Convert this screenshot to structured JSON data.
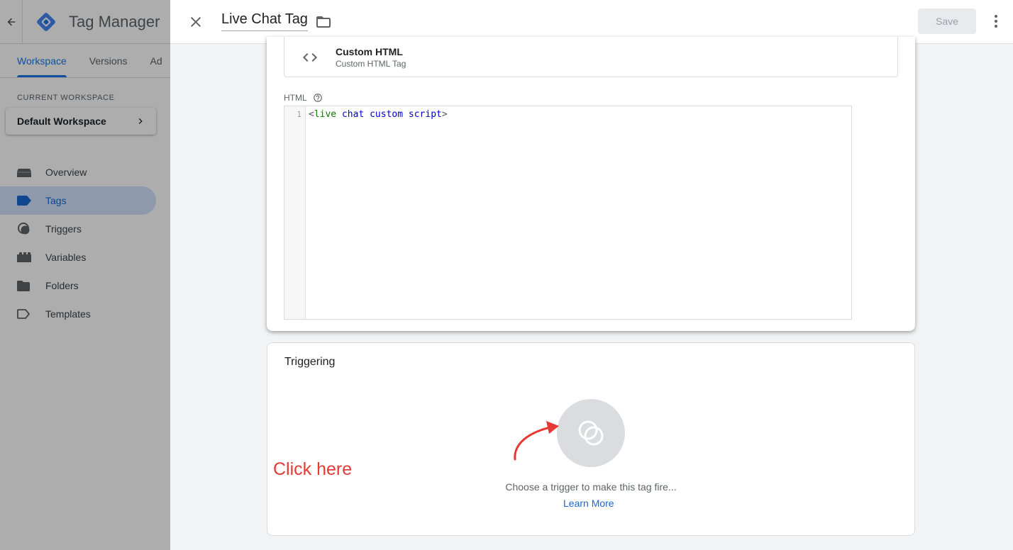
{
  "app": {
    "title": "Tag Manager",
    "tabs": [
      {
        "label": "Workspace",
        "active": true
      },
      {
        "label": "Versions",
        "active": false
      },
      {
        "label": "Ad",
        "active": false
      }
    ],
    "workspace": {
      "label": "CURRENT WORKSPACE",
      "name": "Default Workspace"
    },
    "nav": [
      {
        "label": "Overview",
        "icon": "overview-icon"
      },
      {
        "label": "Tags",
        "icon": "tag-icon",
        "active": true
      },
      {
        "label": "Triggers",
        "icon": "trigger-icon"
      },
      {
        "label": "Variables",
        "icon": "variables-icon"
      },
      {
        "label": "Folders",
        "icon": "folder-icon"
      },
      {
        "label": "Templates",
        "icon": "template-icon"
      }
    ]
  },
  "editor": {
    "tag_name": "Live Chat Tag",
    "save_label": "Save",
    "tag_type": {
      "name": "Custom HTML",
      "description": "Custom HTML Tag"
    },
    "html_label": "HTML",
    "code": {
      "line_number": "1",
      "open": "<",
      "tag": "live",
      "attrs": " chat custom script",
      "close": ">"
    },
    "triggering": {
      "title": "Triggering",
      "hint": "Choose a trigger to make this tag fire...",
      "learn_more": "Learn More"
    }
  },
  "annotation": {
    "text": "Click here",
    "color": "#e53935"
  },
  "colors": {
    "accent": "#1a73e8",
    "active_nav_bg": "#d2e3fc"
  }
}
